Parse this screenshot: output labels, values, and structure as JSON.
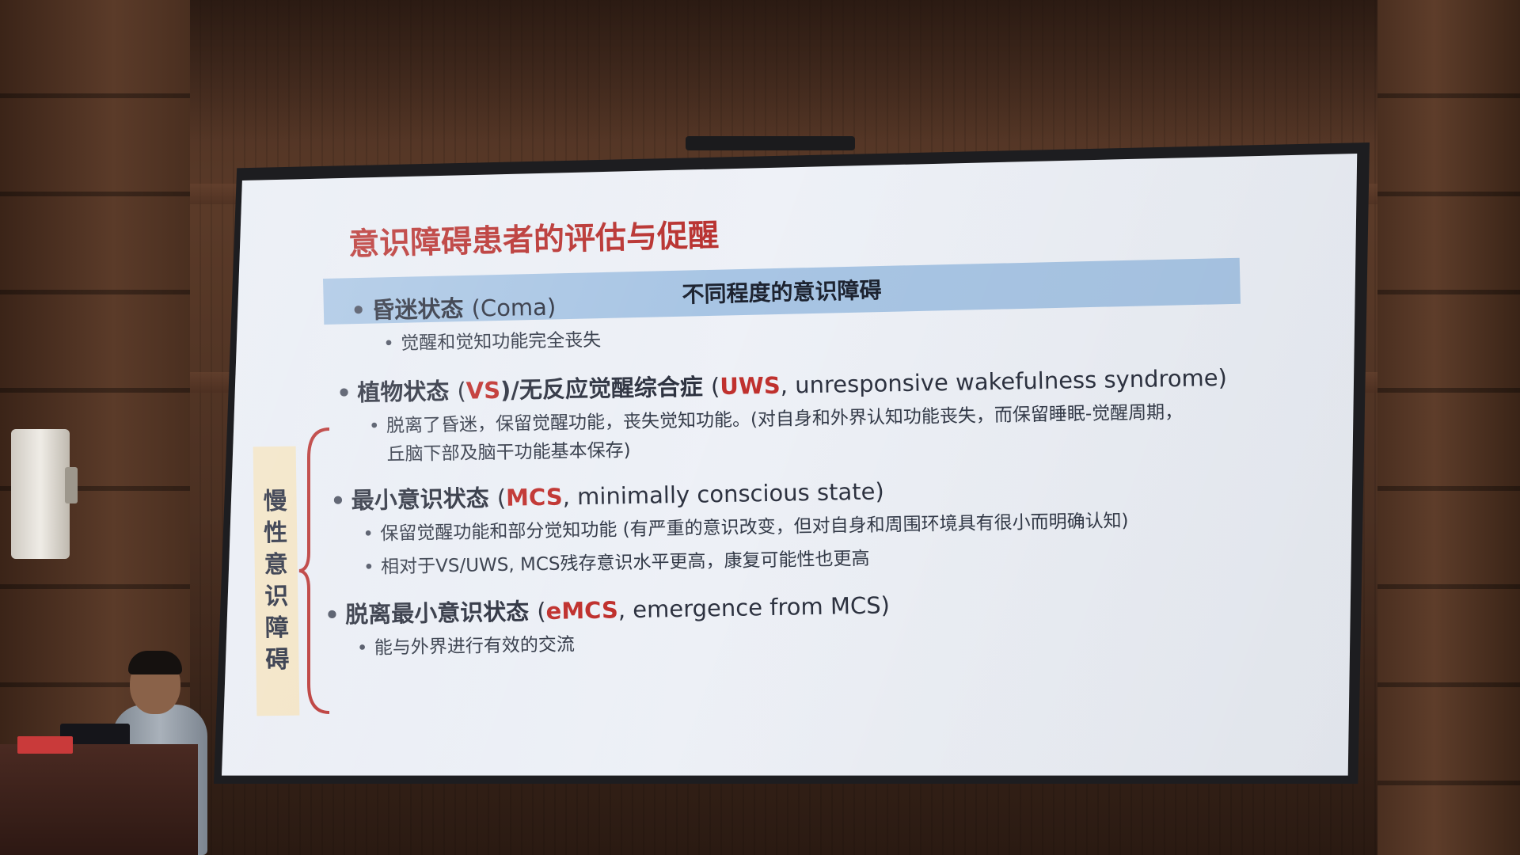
{
  "slide": {
    "title": "意识障碍患者的评估与促醒",
    "section_header": "不同程度的意识障碍",
    "side_label_chars": [
      "慢",
      "性",
      "意",
      "识",
      "障",
      "碍"
    ],
    "coma": {
      "cn": "昏迷状态",
      "en": "(Coma)",
      "detail": "觉醒和觉知功能完全丧失"
    },
    "vs": {
      "cn": "植物状态",
      "p1": "(",
      "abbr": "VS",
      "p2": ")/无反应觉醒综合症",
      "p3": "(",
      "abbr2": "UWS",
      "en": ", unresponsive wakefulness syndrome)",
      "detail_line1": "脱离了昏迷，保留觉醒功能，丧失觉知功能。(对自身和外界认知功能丧失，而保留睡眠-觉醒周期，",
      "detail_line2": "丘脑下部及脑干功能基本保存)"
    },
    "mcs": {
      "cn": "最小意识状态",
      "p1": "(",
      "abbr": "MCS",
      "en": ", minimally conscious state)",
      "detail1": "保留觉醒功能和部分觉知功能 (有严重的意识改变，但对自身和周围环境具有很小而明确认知)",
      "detail2": "相对于VS/UWS, MCS残存意识水平更高，康复可能性也更高"
    },
    "emcs": {
      "cn": "脱离最小意识状态",
      "p1": "(",
      "abbr": "eMCS",
      "en": ", emergence from MCS)",
      "detail": "能与外界进行有效的交流"
    },
    "colors": {
      "title_red": "#b8312f",
      "accent_red": "#c0312e",
      "band_blue": "#a8c5e4",
      "label_bg": "#f2e3c3"
    }
  }
}
